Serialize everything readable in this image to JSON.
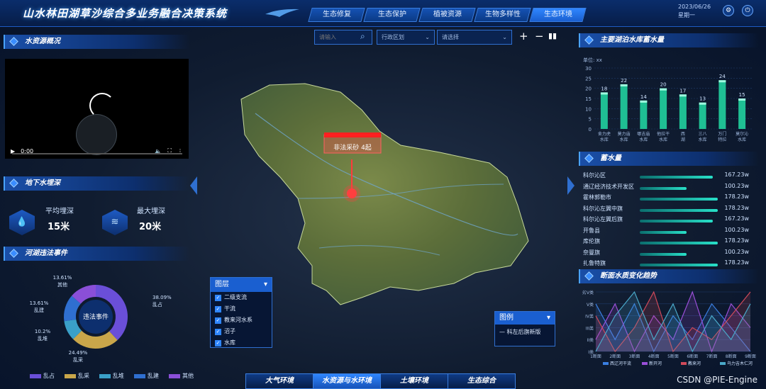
{
  "header": {
    "title": "山水林田湖草沙综合多业务融合决策系统",
    "tabs": [
      "生态修复",
      "生态保护",
      "植被资源",
      "生物多样性",
      "生态环境"
    ],
    "active_tab": "生态环境",
    "date": "2023/06/26",
    "weekday": "星期一"
  },
  "water_resources": {
    "title": "水资源概况",
    "time": "0:00"
  },
  "groundwater": {
    "title": "地下水埋深",
    "avg_label": "平均埋深",
    "avg_value": "15米",
    "max_label": "最大埋深",
    "max_value": "20米"
  },
  "violations": {
    "title": "河湖违法事件",
    "center_label": "违法事件",
    "slices": [
      {
        "pct": "38.09%",
        "label": "乱占",
        "value": 38.09,
        "color": "#6a4fd8"
      },
      {
        "pct": "24.49%",
        "label": "乱采",
        "value": 24.49,
        "color": "#c9a64a"
      },
      {
        "pct": "10.2%",
        "label": "乱堆",
        "value": 10.2,
        "color": "#3aa0c8"
      },
      {
        "pct": "13.61%",
        "label": "乱建",
        "value": 13.61,
        "color": "#2f6fd0"
      },
      {
        "pct": "13.61%",
        "label": "其他",
        "value": 13.61,
        "color": "#8a4fd8"
      }
    ],
    "legend": [
      "乱占",
      "乱采",
      "乱堆",
      "乱建",
      "其他"
    ]
  },
  "map": {
    "search_placeholder": "请输入",
    "region_select": "行政区划",
    "filter_select": "请选择",
    "popup_label": "非法采砂 4起",
    "layers_title": "图层",
    "layers": [
      "二级支流",
      "干流",
      "教来河水系",
      "沼子",
      "水库"
    ],
    "legend_title": "图例",
    "legend_item": "科左后旗新版"
  },
  "reservoir_storage": {
    "title": "主要湖泊水库蓄水量",
    "unit": "单位: xx",
    "y_ticks": [
      "30",
      "25",
      "20",
      "15",
      "10",
      "5",
      "0"
    ]
  },
  "storage_ranking": {
    "title": "蓄水量",
    "rows": [
      {
        "name": "科尔沁区",
        "value": "167.23w",
        "pct": 0.94
      },
      {
        "name": "通辽经济技术开发区",
        "value": "100.23w",
        "pct": 0.6
      },
      {
        "name": "霍林郭勒市",
        "value": "178.23w",
        "pct": 1.0
      },
      {
        "name": "科尔沁左翼中旗",
        "value": "178.23w",
        "pct": 1.0
      },
      {
        "name": "科尔沁左翼后旗",
        "value": "167.23w",
        "pct": 0.94
      },
      {
        "name": "开鲁县",
        "value": "100.23w",
        "pct": 0.6
      },
      {
        "name": "库伦旗",
        "value": "178.23w",
        "pct": 1.0
      },
      {
        "name": "奈曼旗",
        "value": "100.23w",
        "pct": 0.6
      },
      {
        "name": "扎鲁特旗",
        "value": "178.23w",
        "pct": 1.0
      }
    ]
  },
  "water_quality": {
    "title": "断面水质变化趋势",
    "y_ticks": [
      "劣V类",
      "V类",
      "IV类",
      "III类",
      "II类",
      "I类"
    ]
  },
  "bottom_tabs": [
    "大气环境",
    "水资源与水环境",
    "土壤环境",
    "生态综合"
  ],
  "bottom_active": "水资源与水环境",
  "watermark": "CSDN @PIE-Engine",
  "chart_data": [
    {
      "type": "bar",
      "title": "主要湖泊水库蓄水量",
      "ylabel": "单位: xx",
      "ylim": [
        0,
        30
      ],
      "categories": [
        "舍力虎水库",
        "莫力庙水库",
        "哪吉庙水库",
        "他拉干水库",
        "西湖",
        "三八水库",
        "万门特拉",
        "莫尔沁水库"
      ],
      "values": [
        18,
        22,
        14,
        20,
        17,
        13,
        24,
        15
      ]
    },
    {
      "type": "line",
      "title": "断面水质变化趋势",
      "categories": [
        "1断面",
        "2断面",
        "3断面",
        "4断面",
        "5断面",
        "6断面",
        "7断面",
        "8断面",
        "9断面"
      ],
      "y_categories": [
        "I类",
        "II类",
        "III类",
        "IV类",
        "V类",
        "劣V类"
      ],
      "series": [
        {
          "name": "西辽河干流",
          "color": "#3a7ee0",
          "values": [
            5,
            2,
            5,
            1,
            4,
            2,
            5,
            3,
            1
          ]
        },
        {
          "name": "新开河",
          "color": "#9a4fd8",
          "values": [
            2,
            5,
            1,
            4,
            2,
            6,
            1,
            5,
            3
          ]
        },
        {
          "name": "教来河",
          "color": "#d04a5a",
          "values": [
            4,
            1,
            3,
            6,
            1,
            3,
            2,
            4,
            6
          ]
        },
        {
          "name": "乌力吉木仁河",
          "color": "#4aa8c8",
          "values": [
            1,
            4,
            6,
            2,
            5,
            1,
            4,
            2,
            5
          ]
        }
      ]
    }
  ]
}
